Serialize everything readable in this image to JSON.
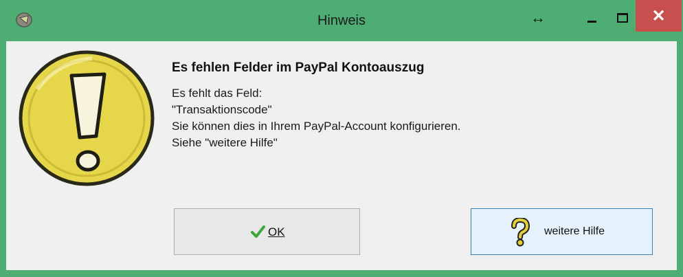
{
  "window": {
    "title": "Hinweis",
    "icon": "app-icon",
    "controls": {
      "resize_glyph": "↔",
      "minimize": "minimize-icon",
      "maximize": "maximize-icon",
      "close_glyph": "✕"
    }
  },
  "message": {
    "heading": "Es fehlen Felder im PayPal Kontoauszug",
    "lines": [
      "Es fehlt das Feld:",
      "\"Transaktionscode\"",
      "Sie können dies in Ihrem PayPal-Account konfigurieren.",
      "Siehe \"weitere Hilfe\""
    ]
  },
  "buttons": {
    "ok_label": "OK",
    "help_label": "weitere Hilfe"
  },
  "colors": {
    "titlebar": "#4ead72",
    "close": "#c7504f",
    "client": "#f0f0f0",
    "warning_fill": "#e6d74a"
  }
}
